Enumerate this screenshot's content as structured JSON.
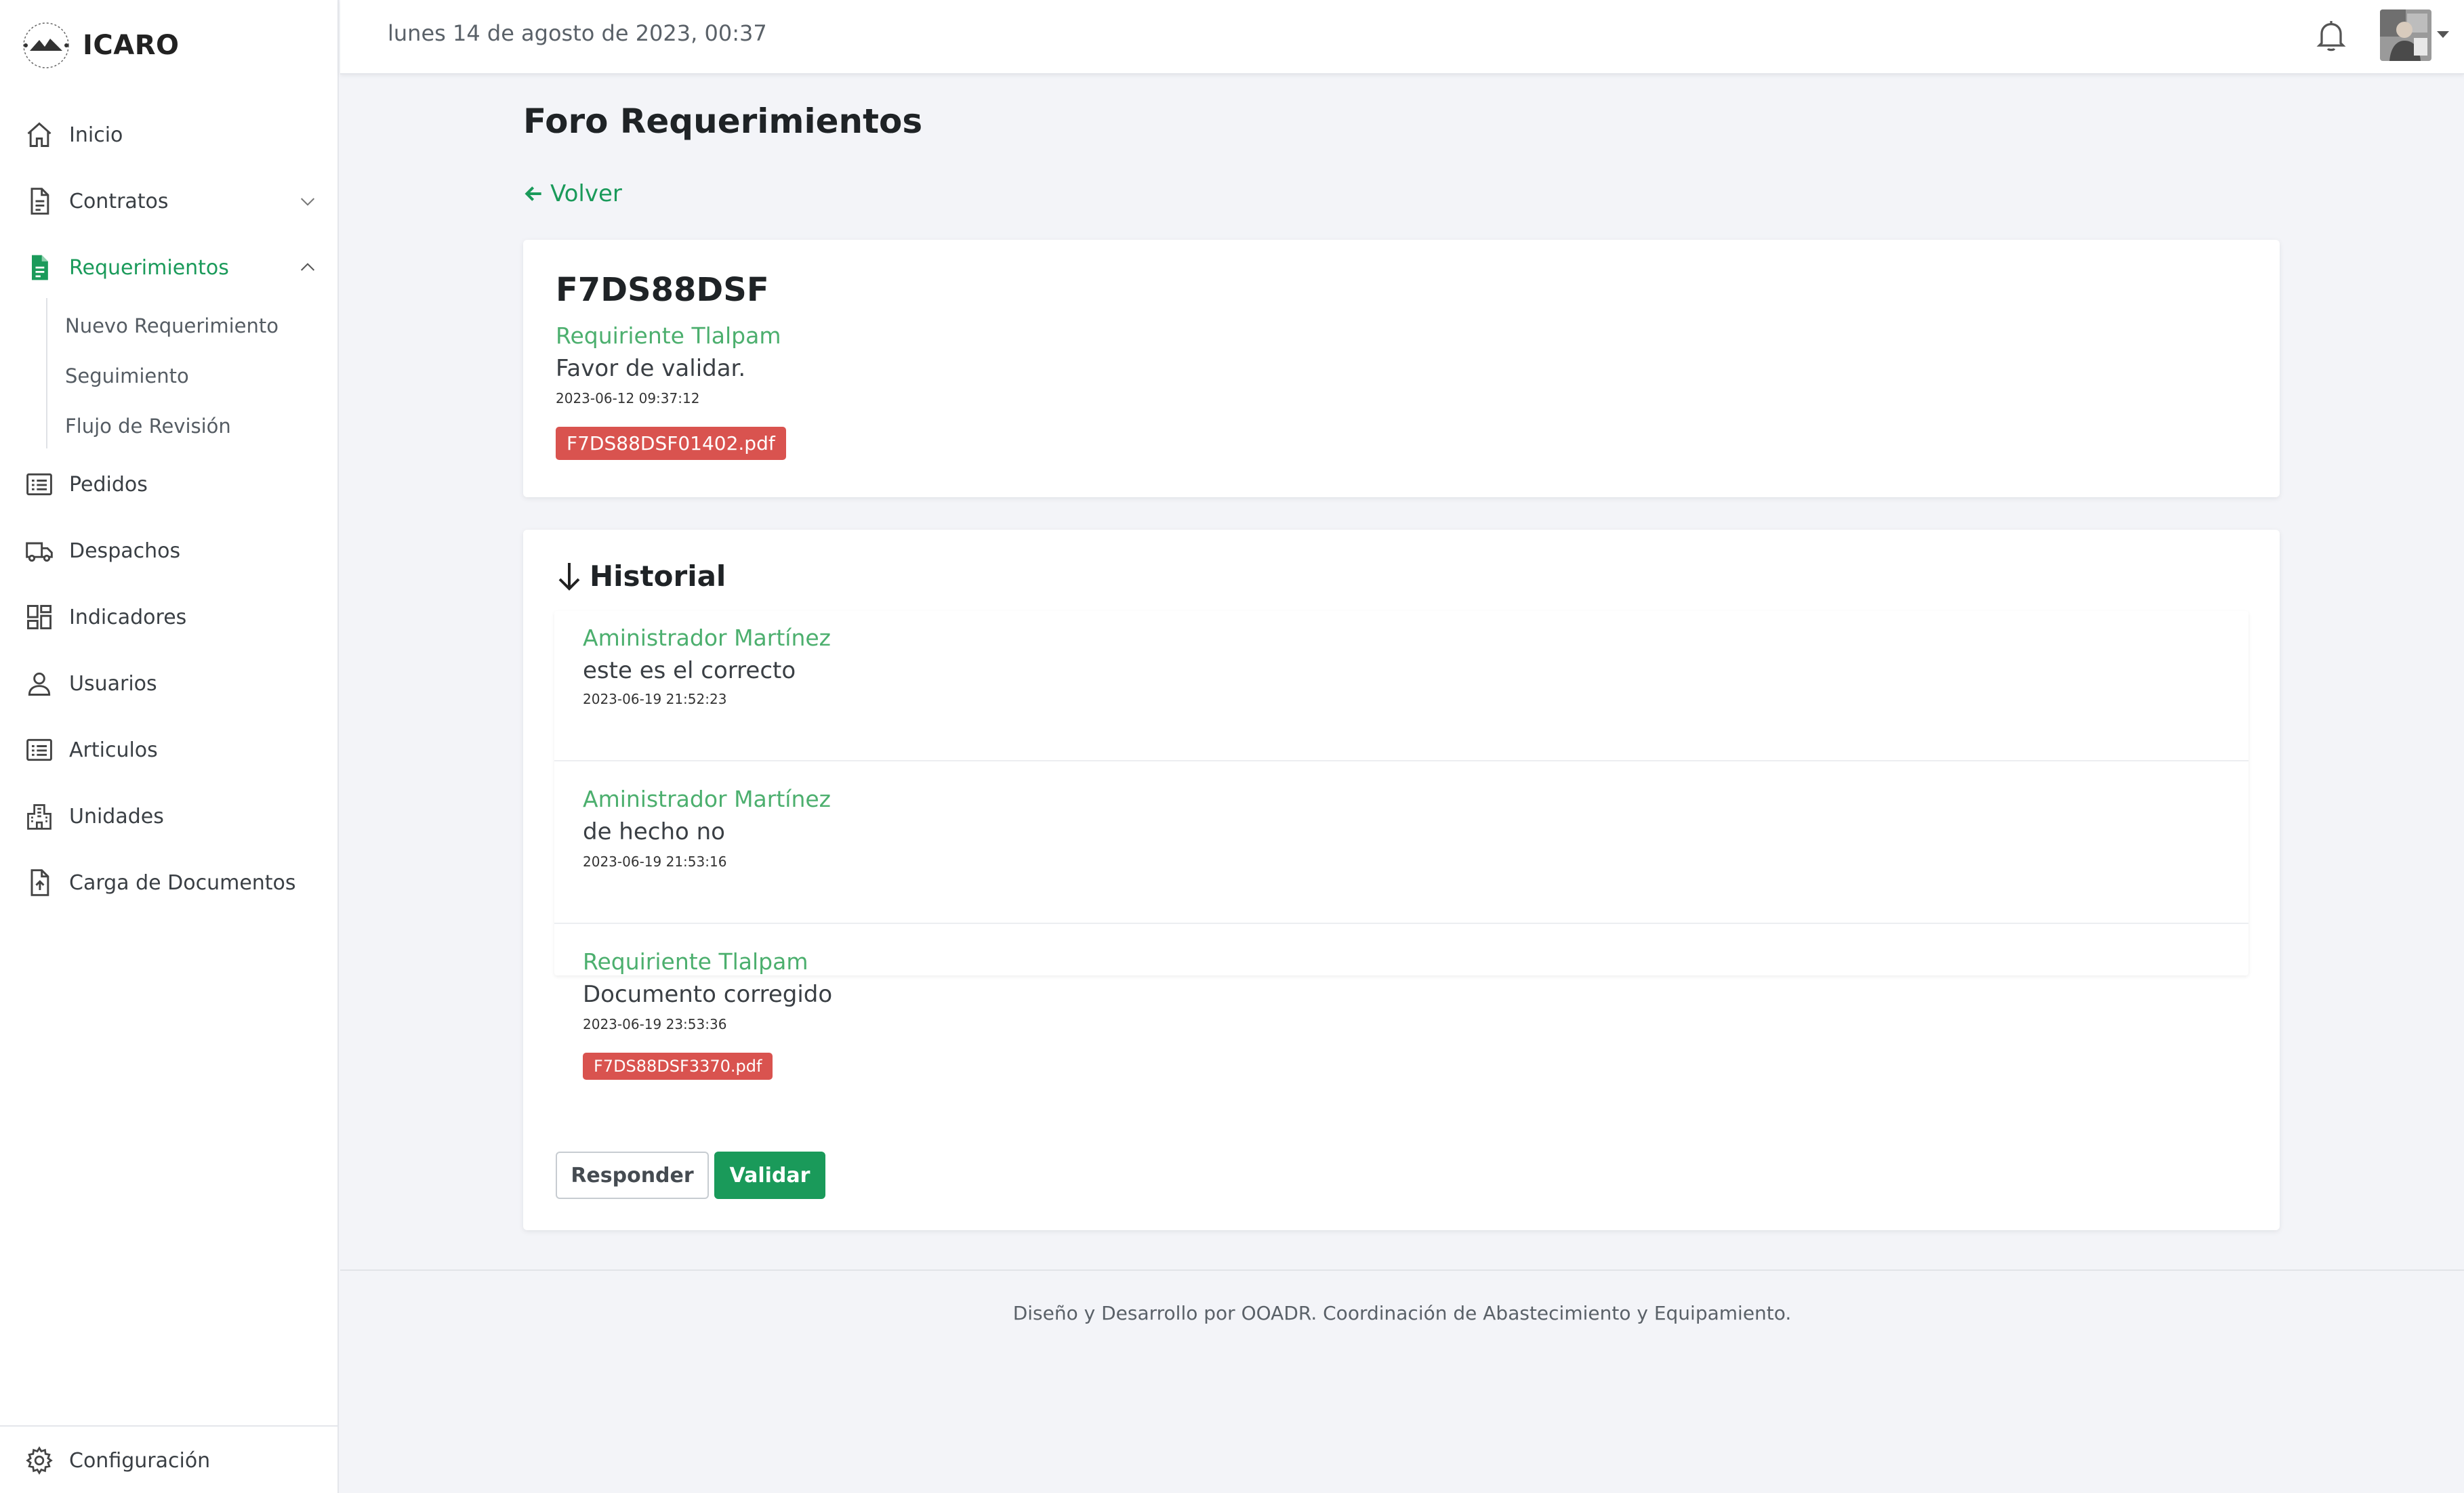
{
  "app": {
    "name": "ICARO"
  },
  "sidebar": {
    "items": [
      {
        "label": "Inicio",
        "icon": "home-icon"
      },
      {
        "label": "Contratos",
        "icon": "document-icon",
        "expandable": true,
        "expanded": false
      },
      {
        "label": "Requerimientos",
        "icon": "document-filled-icon",
        "expandable": true,
        "expanded": true,
        "active": true
      },
      {
        "label": "Pedidos",
        "icon": "list-icon"
      },
      {
        "label": "Despachos",
        "icon": "truck-icon"
      },
      {
        "label": "Indicadores",
        "icon": "dashboard-icon"
      },
      {
        "label": "Usuarios",
        "icon": "user-icon"
      },
      {
        "label": "Articulos",
        "icon": "list-icon"
      },
      {
        "label": "Unidades",
        "icon": "building-icon"
      },
      {
        "label": "Carga de Documentos",
        "icon": "upload-file-icon"
      }
    ],
    "subitems": [
      {
        "label": "Nuevo Requerimiento"
      },
      {
        "label": "Seguimiento"
      },
      {
        "label": "Flujo de Revisión"
      }
    ],
    "footer": {
      "label": "Configuración",
      "icon": "gear-icon"
    }
  },
  "topbar": {
    "date": "lunes 14 de agosto de 2023, 00:37"
  },
  "page": {
    "title": "Foro Requerimientos",
    "back_label": "Volver"
  },
  "request": {
    "code": "F7DS88DSF",
    "author": "Requiriente Tlalpam",
    "message": "Favor de validar.",
    "timestamp": "2023-06-12 09:37:12",
    "attachment": "F7DS88DSF01402.pdf"
  },
  "history": {
    "title": "Historial",
    "entries": [
      {
        "author": "Aministrador Martínez",
        "message": "este es el correcto",
        "timestamp": "2023-06-19 21:52:23"
      },
      {
        "author": "Aministrador Martínez",
        "message": "de hecho no",
        "timestamp": "2023-06-19 21:53:16"
      },
      {
        "author": "Requiriente Tlalpam",
        "message": "Documento corregido",
        "timestamp": "2023-06-19 23:53:36",
        "attachment": "F7DS88DSF3370.pdf"
      }
    ]
  },
  "actions": {
    "reply_label": "Responder",
    "validate_label": "Validar"
  },
  "footer": {
    "text": "Diseño y Desarrollo por OOADR. Coordinación de Abastecimiento y Equipamiento."
  },
  "colors": {
    "accent": "#1a9a5a",
    "author": "#4caf6e",
    "attachment": "#d9534f"
  }
}
